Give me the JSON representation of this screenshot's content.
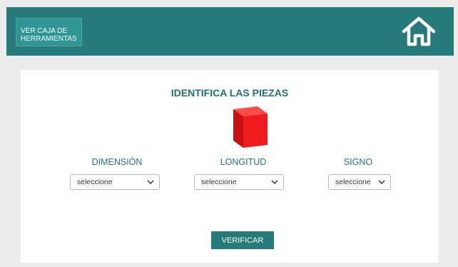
{
  "header": {
    "toolbox_label": "VER CAJA DE\nHERRAMIENTAS",
    "home_icon": "home-icon"
  },
  "main": {
    "title": "IDENTIFICA LAS PIEZAS",
    "piece_icon": "cube-icon",
    "piece_color": "#e8141b",
    "fields": [
      {
        "label": "DIMENSIÓN",
        "value": "seleccione"
      },
      {
        "label": "LONGITUD",
        "value": "seleccione"
      },
      {
        "label": "SIGNO",
        "value": "seleccione"
      }
    ],
    "verify_label": "VERIFICAR"
  },
  "colors": {
    "accent": "#267a7a",
    "title": "#1f6e78",
    "label": "#2a6f8c"
  }
}
